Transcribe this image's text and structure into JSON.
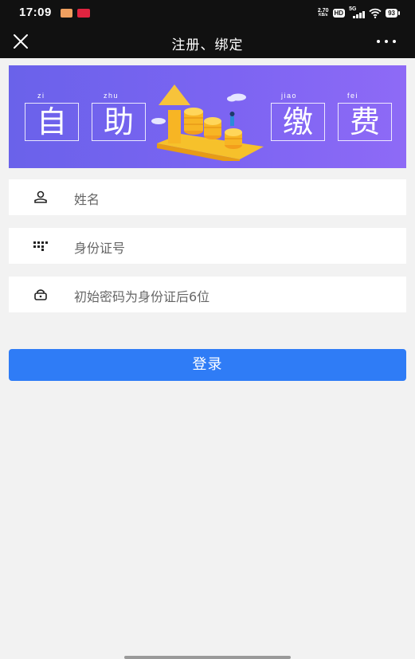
{
  "status_bar": {
    "time": "17:09",
    "net_speed_value": "2.70",
    "net_speed_unit": "KB/s",
    "hd_label": "HD",
    "network_label": "5G",
    "battery_level": "93"
  },
  "nav": {
    "title": "注册、绑定",
    "close_icon": "close-icon",
    "more_icon": "more-icon"
  },
  "banner": {
    "chars": [
      {
        "pinyin": "zi",
        "char": "自"
      },
      {
        "pinyin": "zhu",
        "char": "助"
      },
      {
        "pinyin": "jiao",
        "char": "缴"
      },
      {
        "pinyin": "fei",
        "char": "费"
      }
    ]
  },
  "form": {
    "name_placeholder": "姓名",
    "id_placeholder": "身份证号",
    "password_placeholder": "初始密码为身份证后6位",
    "login_label": "登录"
  },
  "colors": {
    "primary": "#2f7cf6",
    "banner_start": "#6a62ea",
    "banner_end": "#8e6af6",
    "bar_bg": "#111111",
    "page_bg": "#f2f2f2"
  }
}
